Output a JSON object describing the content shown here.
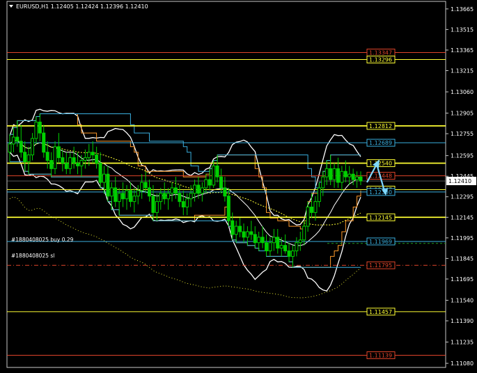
{
  "header": {
    "text": "EURUSD,H1  1.12405 1.12424 1.12396 1.12410"
  },
  "colors": {
    "background": "#000000",
    "candles": "#00d000",
    "price_axis_text": "#ffffff",
    "yellow_levels": "#ffff33",
    "red_levels": "#e0442a",
    "cyan_levels": "#3ab0e0",
    "bands": "#ffffff",
    "channel_orange": "#ff9a2a",
    "arrows": "#7fd8ff"
  },
  "chart_data": {
    "type": "candlestick",
    "symbol": "EURUSD",
    "timeframe": "H1",
    "ylim": [
      1.1105,
      1.1372
    ],
    "y_ticks": [
      "1.13665",
      "1.13515",
      "1.13365",
      "1.13215",
      "1.13060",
      "1.12905",
      "1.12755",
      "1.12595",
      "1.12445",
      "1.12295",
      "1.12145",
      "1.11995",
      "1.11845",
      "1.11695",
      "1.11540",
      "1.11390",
      "1.11235",
      "1.11080"
    ],
    "current_price": "1.12410",
    "levels": [
      {
        "name": "red-level-top",
        "price": "1.13347",
        "color": "#e0442a",
        "style": "solid"
      },
      {
        "name": "yellow-level-top",
        "price": "1.13296",
        "color": "#ffff33",
        "style": "solid"
      },
      {
        "name": "yellow-resistance",
        "price": "1.12812",
        "color": "#ffff33",
        "style": "solid"
      },
      {
        "name": "cyan-level-high",
        "price": "1.12689",
        "color": "#3ab0e0",
        "style": "solid"
      },
      {
        "name": "yellow-level-mid",
        "price": "1.12540",
        "color": "#ffff33",
        "style": "solid"
      },
      {
        "name": "red-level-mid",
        "price": "1.12448",
        "color": "#e0442a",
        "style": "solid"
      },
      {
        "name": "yellow-level-low",
        "price": "1.12347",
        "color": "#ffff33",
        "style": "solid"
      },
      {
        "name": "cyan-level-low",
        "price": "1.12330",
        "color": "#3ab0e0",
        "style": "solid"
      },
      {
        "name": "yellow-support",
        "price": "1.12145",
        "color": "#ffff33",
        "style": "solid"
      },
      {
        "name": "cyan-order-line",
        "price": "1.11969",
        "color": "#3ab0e0",
        "style": "solid"
      },
      {
        "name": "red-sl-line",
        "price": "1.11795",
        "color": "#e0442a",
        "style": "dashdot"
      },
      {
        "name": "yellow-level-bottom",
        "price": "1.11457",
        "color": "#ffff33",
        "style": "solid"
      },
      {
        "name": "red-level-bottom",
        "price": "1.11139",
        "color": "#e0442a",
        "style": "solid"
      }
    ],
    "annotations": [
      "#1880408025 buy 0.29",
      "#1880408025 sl"
    ],
    "candles": [
      [
        1.1262,
        1.1275,
        1.1255,
        1.1268
      ],
      [
        1.1268,
        1.128,
        1.1262,
        1.1273
      ],
      [
        1.1273,
        1.1285,
        1.1266,
        1.127
      ],
      [
        1.127,
        1.1282,
        1.1258,
        1.1262
      ],
      [
        1.1262,
        1.127,
        1.1248,
        1.1255
      ],
      [
        1.1255,
        1.1266,
        1.1246,
        1.126
      ],
      [
        1.126,
        1.1276,
        1.1256,
        1.1272
      ],
      [
        1.1272,
        1.1288,
        1.1268,
        1.1284
      ],
      [
        1.1284,
        1.129,
        1.127,
        1.1276
      ],
      [
        1.1276,
        1.1282,
        1.1258,
        1.1262
      ],
      [
        1.1262,
        1.127,
        1.125,
        1.1256
      ],
      [
        1.1256,
        1.1262,
        1.1244,
        1.125
      ],
      [
        1.125,
        1.127,
        1.1246,
        1.1266
      ],
      [
        1.1266,
        1.1276,
        1.1254,
        1.1258
      ],
      [
        1.1258,
        1.1264,
        1.1248,
        1.1254
      ],
      [
        1.1254,
        1.1262,
        1.1246,
        1.125
      ],
      [
        1.125,
        1.1262,
        1.1246,
        1.1258
      ],
      [
        1.1258,
        1.1266,
        1.125,
        1.1254
      ],
      [
        1.1254,
        1.1262,
        1.1246,
        1.1252
      ],
      [
        1.1252,
        1.126,
        1.1244,
        1.1256
      ],
      [
        1.1256,
        1.1264,
        1.125,
        1.1258
      ],
      [
        1.1258,
        1.1268,
        1.1252,
        1.1262
      ],
      [
        1.1262,
        1.127,
        1.1254,
        1.126
      ],
      [
        1.126,
        1.1266,
        1.125,
        1.1254
      ],
      [
        1.1254,
        1.1262,
        1.1236,
        1.124
      ],
      [
        1.124,
        1.1252,
        1.1232,
        1.1246
      ],
      [
        1.1246,
        1.1252,
        1.1226,
        1.123
      ],
      [
        1.123,
        1.124,
        1.122,
        1.1236
      ],
      [
        1.1236,
        1.1244,
        1.1222,
        1.1226
      ],
      [
        1.1226,
        1.1236,
        1.1216,
        1.1232
      ],
      [
        1.1232,
        1.124,
        1.1222,
        1.1228
      ],
      [
        1.1228,
        1.1238,
        1.122,
        1.1234
      ],
      [
        1.1234,
        1.124,
        1.1222,
        1.1226
      ],
      [
        1.1226,
        1.1236,
        1.1218,
        1.123
      ],
      [
        1.123,
        1.1238,
        1.1224,
        1.1234
      ],
      [
        1.1234,
        1.1246,
        1.1228,
        1.124
      ],
      [
        1.124,
        1.1248,
        1.1232,
        1.1236
      ],
      [
        1.1236,
        1.1242,
        1.1226,
        1.123
      ],
      [
        1.123,
        1.1238,
        1.1212,
        1.1218
      ],
      [
        1.1218,
        1.1232,
        1.1212,
        1.1226
      ],
      [
        1.1226,
        1.1236,
        1.122,
        1.1232
      ],
      [
        1.1232,
        1.124,
        1.1224,
        1.1228
      ],
      [
        1.1228,
        1.1236,
        1.122,
        1.1232
      ],
      [
        1.1232,
        1.124,
        1.1226,
        1.1236
      ],
      [
        1.1236,
        1.1244,
        1.1228,
        1.1232
      ],
      [
        1.1232,
        1.1238,
        1.1222,
        1.1226
      ],
      [
        1.1226,
        1.1234,
        1.1216,
        1.1222
      ],
      [
        1.1222,
        1.1232,
        1.1216,
        1.1228
      ],
      [
        1.1228,
        1.1238,
        1.1222,
        1.1232
      ],
      [
        1.1232,
        1.1242,
        1.1226,
        1.1238
      ],
      [
        1.1238,
        1.1244,
        1.1228,
        1.1232
      ],
      [
        1.1232,
        1.124,
        1.1226,
        1.1236
      ],
      [
        1.1236,
        1.1246,
        1.1232,
        1.1242
      ],
      [
        1.1242,
        1.125,
        1.1234,
        1.1238
      ],
      [
        1.1238,
        1.1256,
        1.1236,
        1.1252
      ],
      [
        1.1252,
        1.126,
        1.124,
        1.1244
      ],
      [
        1.1244,
        1.125,
        1.1232,
        1.1236
      ],
      [
        1.1236,
        1.1244,
        1.1226,
        1.123
      ],
      [
        1.123,
        1.1236,
        1.1208,
        1.1212
      ],
      [
        1.1212,
        1.1218,
        1.1198,
        1.1202
      ],
      [
        1.1202,
        1.1212,
        1.1196,
        1.1208
      ],
      [
        1.1208,
        1.1214,
        1.12,
        1.1204
      ],
      [
        1.1204,
        1.121,
        1.1196,
        1.12
      ],
      [
        1.12,
        1.1208,
        1.1194,
        1.1204
      ],
      [
        1.1204,
        1.1212,
        1.1198,
        1.1202
      ],
      [
        1.1202,
        1.1208,
        1.1192,
        1.1196
      ],
      [
        1.1196,
        1.1204,
        1.119,
        1.12
      ],
      [
        1.12,
        1.1208,
        1.1192,
        1.1196
      ],
      [
        1.1196,
        1.1202,
        1.1186,
        1.119
      ],
      [
        1.119,
        1.12,
        1.1186,
        1.1196
      ],
      [
        1.1196,
        1.1206,
        1.119,
        1.12
      ],
      [
        1.12,
        1.1206,
        1.1188,
        1.1192
      ],
      [
        1.1192,
        1.12,
        1.1186,
        1.1194
      ],
      [
        1.1194,
        1.1202,
        1.1188,
        1.119
      ],
      [
        1.119,
        1.1196,
        1.1182,
        1.1186
      ],
      [
        1.1186,
        1.1194,
        1.1178,
        1.119
      ],
      [
        1.119,
        1.12,
        1.1186,
        1.1196
      ],
      [
        1.1196,
        1.1204,
        1.119,
        1.1198
      ],
      [
        1.1198,
        1.1212,
        1.1194,
        1.1208
      ],
      [
        1.1208,
        1.1226,
        1.1204,
        1.1222
      ],
      [
        1.1222,
        1.1232,
        1.1214,
        1.1218
      ],
      [
        1.1218,
        1.123,
        1.1212,
        1.1226
      ],
      [
        1.1226,
        1.124,
        1.1222,
        1.1236
      ],
      [
        1.1236,
        1.1248,
        1.123,
        1.1244
      ],
      [
        1.1244,
        1.1256,
        1.1238,
        1.125
      ],
      [
        1.125,
        1.126,
        1.1238,
        1.1242
      ],
      [
        1.1242,
        1.1254,
        1.1236,
        1.125
      ],
      [
        1.125,
        1.1258,
        1.1236,
        1.124
      ],
      [
        1.124,
        1.1252,
        1.1234,
        1.1248
      ],
      [
        1.1248,
        1.1256,
        1.124,
        1.1244
      ],
      [
        1.1244,
        1.1252,
        1.1238,
        1.1246
      ],
      [
        1.1246,
        1.125,
        1.1238,
        1.1242
      ],
      [
        1.1242,
        1.1248,
        1.1236,
        1.1244
      ],
      [
        1.1244,
        1.1248,
        1.1238,
        1.1241
      ]
    ]
  }
}
